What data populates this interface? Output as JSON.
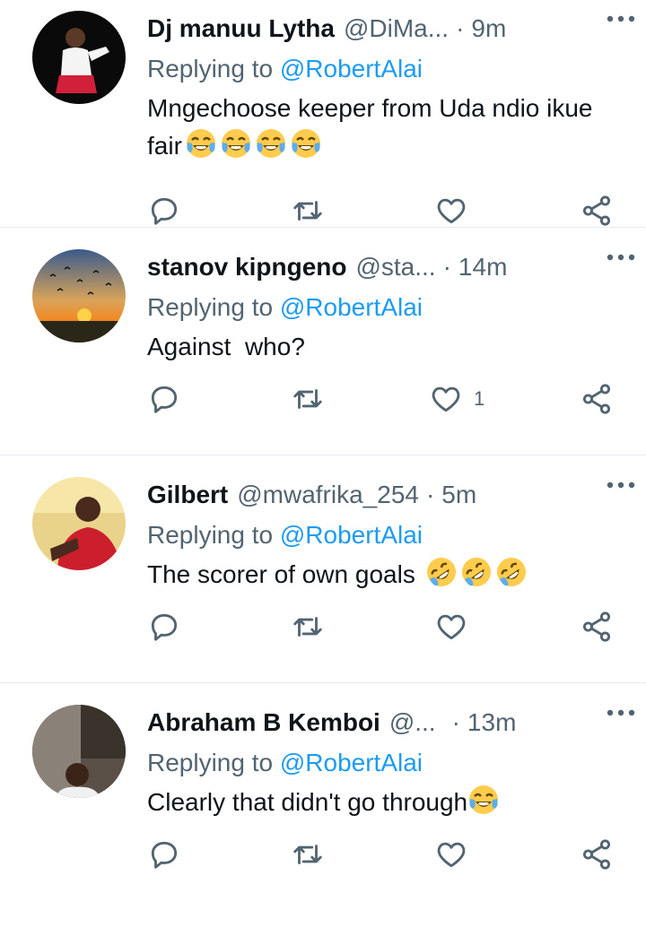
{
  "tweets": [
    {
      "name": "Dj manuu Lytha",
      "handle": "@DiMa...",
      "separator": "·",
      "time": "9m",
      "replying_prefix": "Replying to ",
      "replying_to": "@RobertAlai",
      "text": "Mngechoose keeper from Uda ndio ikue fair",
      "emojis": [
        "face-with-tears-of-joy",
        "face-with-tears-of-joy",
        "face-with-tears-of-joy",
        "face-with-tears-of-joy"
      ],
      "like_count": ""
    },
    {
      "name": "stanov kipngeno",
      "handle": "@sta...",
      "separator": "·",
      "time": "14m",
      "replying_prefix": "Replying to ",
      "replying_to": "@RobertAlai",
      "text": "Against  who?",
      "emojis": [],
      "like_count": "1"
    },
    {
      "name": "Gilbert",
      "handle": "@mwafrika_254",
      "separator": "·",
      "time": "5m",
      "replying_prefix": "Replying to ",
      "replying_to": "@RobertAlai",
      "text": "The scorer of own goals ",
      "emojis": [
        "rolling-on-floor-laughing",
        "rolling-on-floor-laughing",
        "rolling-on-floor-laughing"
      ],
      "like_count": ""
    },
    {
      "name": "Abraham B Kemboi",
      "handle": "@...",
      "separator": "·",
      "time": "13m",
      "replying_prefix": "Replying to ",
      "replying_to": "@RobertAlai",
      "text": "Clearly that didn't go through",
      "emojis": [
        "face-with-tears-of-joy"
      ],
      "like_count": ""
    }
  ],
  "icons": {
    "reply": "reply-icon",
    "retweet": "retweet-icon",
    "like": "heart-icon",
    "share": "share-icon",
    "more": "more-icon"
  },
  "colors": {
    "text": "#0f1419",
    "secondary": "#536471",
    "link": "#1d9bf0",
    "divider": "#e6ecf0"
  }
}
